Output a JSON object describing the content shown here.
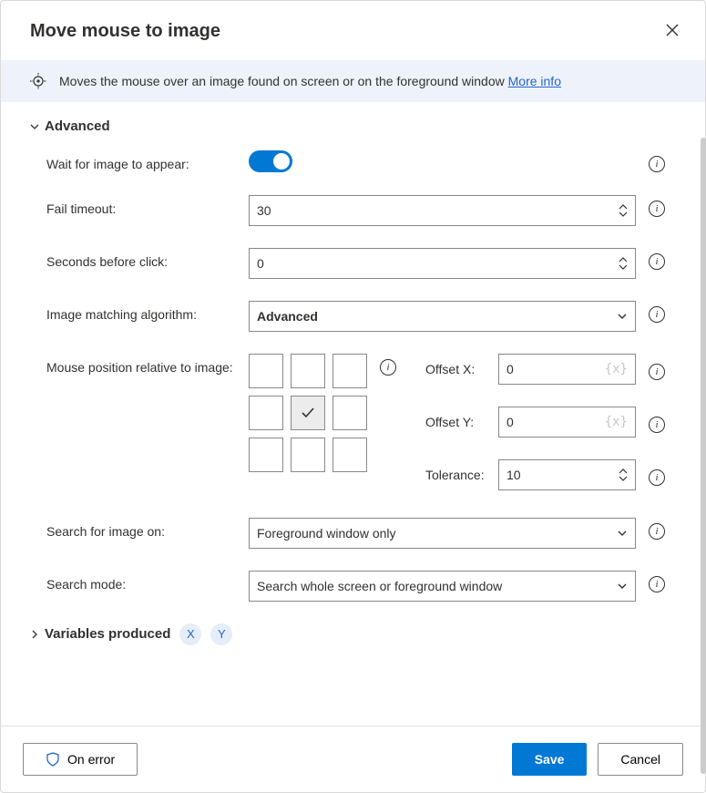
{
  "header": {
    "title": "Move mouse to image"
  },
  "banner": {
    "text": "Moves the mouse over an image found on screen or on the foreground window ",
    "link": "More info"
  },
  "section_advanced": {
    "title": "Advanced"
  },
  "fields": {
    "wait_for_image": {
      "label": "Wait for image to appear:"
    },
    "fail_timeout": {
      "label": "Fail timeout:",
      "value": "30"
    },
    "seconds_before_click": {
      "label": "Seconds before click:",
      "value": "0"
    },
    "matching_algo": {
      "label": "Image matching algorithm:",
      "value": "Advanced"
    },
    "mouse_pos": {
      "label": "Mouse position relative to image:"
    },
    "offset_x": {
      "label": "Offset X:",
      "value": "0"
    },
    "offset_y": {
      "label": "Offset Y:",
      "value": "0"
    },
    "tolerance": {
      "label": "Tolerance:",
      "value": "10"
    },
    "search_on": {
      "label": "Search for image on:",
      "value": "Foreground window only"
    },
    "search_mode": {
      "label": "Search mode:",
      "value": "Search whole screen or foreground window"
    }
  },
  "section_vars": {
    "title": "Variables produced",
    "pills": {
      "x": "X",
      "y": "Y"
    }
  },
  "footer": {
    "on_error": "On error",
    "save": "Save",
    "cancel": "Cancel"
  }
}
